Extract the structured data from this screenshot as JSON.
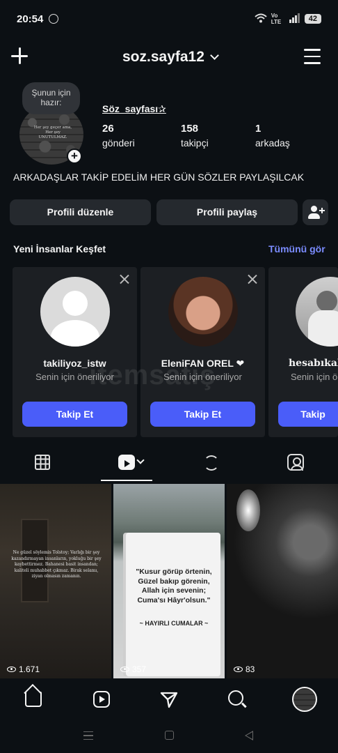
{
  "status_bar": {
    "time": "20:54",
    "network": "Vo LTE",
    "battery": "42"
  },
  "top_bar": {
    "username": "soz.sayfa12"
  },
  "profile": {
    "note": "Şunun için hazır:",
    "avatar_text": "Her şey geçer ama, Her şey UNUTULMAZ.",
    "display_name": "Söz_sayfası✰",
    "stats": [
      {
        "number": "26",
        "label": "gönderi"
      },
      {
        "number": "158",
        "label": "takipçi"
      },
      {
        "number": "1",
        "label": "arkadaş"
      }
    ],
    "bio": "ARKADAŞLAR TAKİP EDELİM HER GÜN SÖZLER PAYLAŞILCAK"
  },
  "buttons": {
    "edit": "Profili düzenle",
    "share": "Profili paylaş"
  },
  "discover": {
    "title": "Yeni İnsanlar Keşfet",
    "see_all": "Tümünü gör",
    "cards": [
      {
        "username": "takiliyoz_istw",
        "subtitle": "Senin için öneriliyor",
        "follow": "Takip Et"
      },
      {
        "username": "EleniFAN OREL ❤",
        "subtitle": "Senin için öneriliyor",
        "follow": "Takip Et"
      },
      {
        "username": "hesabıkalan",
        "subtitle": "Senin için ö",
        "follow": "Takip"
      }
    ]
  },
  "watermark": "itemsatış",
  "posts": [
    {
      "text": "Ne güzel söylemis Tolstoy; Varlığı bir şey kazandırmayan insanların, yokluğu bir şey kaybettirmez. Bahanesi basit insandan; kaliteli muhabbet çıkmaz. Birak selamı, ziyan olmasın zamanın.",
      "views": "1.671"
    },
    {
      "text": "\"Kusur görüp örtenin, Güzel bakıp görenin, Allah için sevenin; Cuma'sı Hâyr'olsun.\"",
      "text2": "~ HAYIRLI CUMALAR ~",
      "views": "357"
    },
    {
      "views": "83"
    }
  ],
  "icons": {
    "top": [
      "plus-icon",
      "chevron-down-icon",
      "menu-icon"
    ],
    "tabs": [
      "grid-icon",
      "reels-icon",
      "repost-icon",
      "tagged-icon"
    ],
    "nav": [
      "home-icon",
      "reels-icon",
      "send-icon",
      "search-icon",
      "profile-avatar"
    ]
  },
  "colors": {
    "background": "#0c1014",
    "button": "#25292e",
    "accent": "#4a5df9",
    "link": "#7b8cff"
  }
}
